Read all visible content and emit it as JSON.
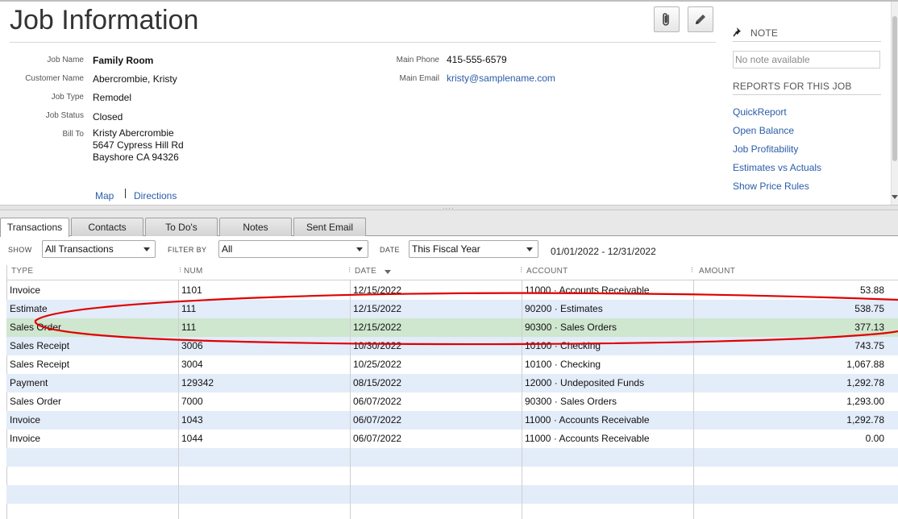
{
  "page": {
    "title": "Job Information"
  },
  "fields": {
    "job_name": {
      "label": "Job Name",
      "value": "Family Room"
    },
    "customer_name": {
      "label": "Customer Name",
      "value": "Abercrombie, Kristy"
    },
    "job_type": {
      "label": "Job Type",
      "value": "Remodel"
    },
    "job_status": {
      "label": "Job Status",
      "value": "Closed"
    },
    "bill_to": {
      "label": "Bill To",
      "line1": "Kristy Abercrombie",
      "line2": "5647 Cypress Hill Rd",
      "line3": "Bayshore CA 94326"
    },
    "main_phone": {
      "label": "Main Phone",
      "value": "415-555-6579"
    },
    "main_email": {
      "label": "Main Email",
      "value": "kristy@samplename.com"
    },
    "map_link": "Map",
    "directions_link": "Directions"
  },
  "right_panel": {
    "note_heading": "NOTE",
    "note_text": "No note available",
    "reports_heading": "REPORTS FOR THIS JOB",
    "reports": [
      "QuickReport",
      "Open Balance",
      "Job Profitability",
      "Estimates vs Actuals",
      "Show Price Rules"
    ]
  },
  "tabs": [
    {
      "label": "Transactions",
      "active": true
    },
    {
      "label": "Contacts",
      "active": false
    },
    {
      "label": "To Do's",
      "active": false
    },
    {
      "label": "Notes",
      "active": false
    },
    {
      "label": "Sent Email",
      "active": false
    }
  ],
  "filters": {
    "show_label": "SHOW",
    "show_value": "All Transactions",
    "filter_by_label": "FILTER BY",
    "filter_by_value": "All",
    "date_label": "DATE",
    "date_value": "This Fiscal Year",
    "date_range": "01/01/2022 - 12/31/2022"
  },
  "table": {
    "columns": [
      "TYPE",
      "NUM",
      "DATE",
      "ACCOUNT",
      "AMOUNT"
    ],
    "rows": [
      {
        "type": "Invoice",
        "num": "1101",
        "date": "12/15/2022",
        "account": "11000 · Accounts Receivable",
        "amount": "53.88"
      },
      {
        "type": "Estimate",
        "num": "111",
        "date": "12/15/2022",
        "account": "90200 · Estimates",
        "amount": "538.75"
      },
      {
        "type": "Sales Order",
        "num": "111",
        "date": "12/15/2022",
        "account": "90300 · Sales Orders",
        "amount": "377.13"
      },
      {
        "type": "Sales Receipt",
        "num": "3006",
        "date": "10/30/2022",
        "account": "10100 · Checking",
        "amount": "743.75"
      },
      {
        "type": "Sales Receipt",
        "num": "3004",
        "date": "10/25/2022",
        "account": "10100 · Checking",
        "amount": "1,067.88"
      },
      {
        "type": "Payment",
        "num": "129342",
        "date": "08/15/2022",
        "account": "12000 · Undeposited Funds",
        "amount": "1,292.78"
      },
      {
        "type": "Sales Order",
        "num": "7000",
        "date": "06/07/2022",
        "account": "90300 · Sales Orders",
        "amount": "1,293.00"
      },
      {
        "type": "Invoice",
        "num": "1043",
        "date": "06/07/2022",
        "account": "11000 · Accounts Receivable",
        "amount": "1,292.78"
      },
      {
        "type": "Invoice",
        "num": "1044",
        "date": "06/07/2022",
        "account": "11000 · Accounts Receivable",
        "amount": "0.00"
      }
    ]
  },
  "annotation": {
    "color": "#e00000"
  },
  "icons": {
    "attach": "paperclip-icon",
    "edit": "pencil-icon",
    "note": "pushpin-icon"
  }
}
